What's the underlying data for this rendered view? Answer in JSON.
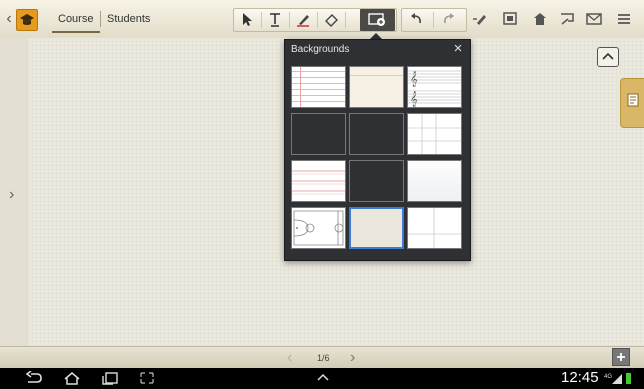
{
  "toolbar": {
    "tabs": [
      {
        "label": "Course"
      },
      {
        "label": "Students"
      }
    ]
  },
  "popup": {
    "title": "Backgrounds",
    "close_label": "×",
    "backgrounds": [
      "lined-notebook",
      "plain-cream",
      "music-staff",
      "red-grid",
      "blue-graph",
      "table-grid",
      "red-lines",
      "fine-grid",
      "plain-white",
      "basketball-court",
      "plain-beige",
      "large-grid"
    ],
    "selected_index": 10
  },
  "pager": {
    "indicator": "1/6"
  },
  "system": {
    "time": "12:45"
  },
  "colors": {
    "accent_orange": "#e89a1a",
    "selection_blue": "#3d7bd6",
    "popup_bg": "#2f3033",
    "side_tab": "#d9b766"
  }
}
